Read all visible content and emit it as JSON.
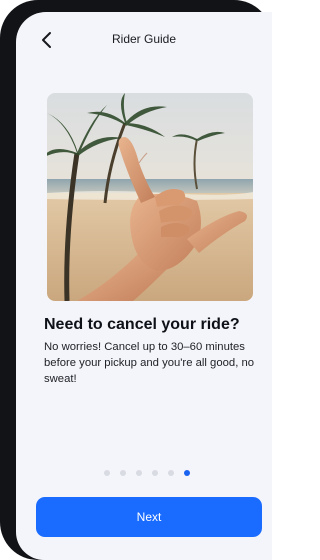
{
  "header": {
    "title": "Rider Guide",
    "back_icon": "chevron-left-icon"
  },
  "hero": {
    "image_description": "shaka-hand-gesture-beach-photo"
  },
  "content": {
    "title": "Need to cancel your ride?",
    "description": "No worries! Cancel up to 30–60 minutes before your pickup and you're all good, no sweat!"
  },
  "pagination": {
    "total": 6,
    "current": 6
  },
  "actions": {
    "next_label": "Next"
  },
  "colors": {
    "accent": "#1a6bff",
    "background": "#f4f5fa",
    "frame": "#111317"
  }
}
